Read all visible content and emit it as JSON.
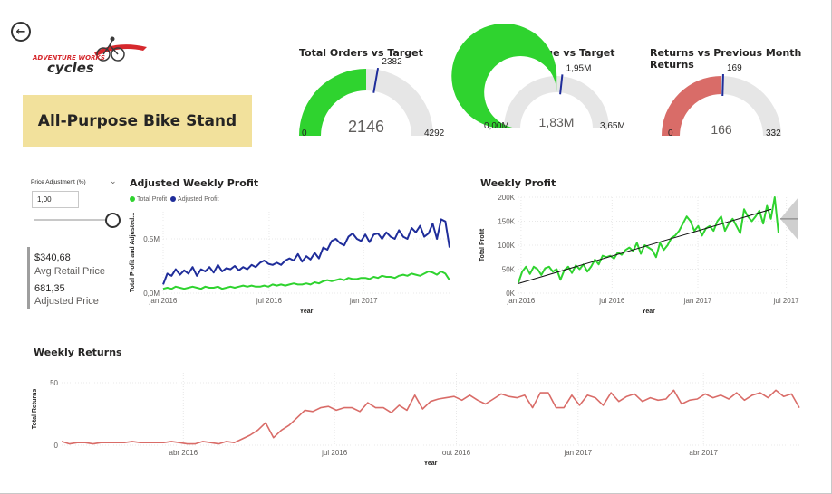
{
  "brand": {
    "logo_text_top": "ADVENTURE WORKS",
    "logo_text_bottom": "cycles"
  },
  "product": {
    "name": "All-Purpose Bike Stand"
  },
  "price_adjustment": {
    "label": "Price Adjustment (%)",
    "value": "1,00",
    "slider_fraction": 1.0
  },
  "kpis": {
    "avg_retail_value": "$340,68",
    "avg_retail_label": "Avg Retail Price",
    "adjusted_value": "681,35",
    "adjusted_label": "Adjusted Price"
  },
  "colors": {
    "green": "#2fd32f",
    "navy": "#1f2d9a",
    "red": "#d96c68",
    "gray": "#e6e6e6",
    "target": "#1f2d9a"
  },
  "gauges": [
    {
      "title": "Total Orders vs Target",
      "value_label": "2146",
      "min_label": "0",
      "max_label": "4292",
      "target_label": "2382",
      "value": 2146,
      "min": 0,
      "max": 4292,
      "target": 2382,
      "color": "#2fd32f"
    },
    {
      "title": "Total Revenue vs Target",
      "value_label": "1,83M",
      "min_label": "0,00M",
      "max_label": "3,65M",
      "target_label": "1,95M",
      "value": 1.83,
      "min": 0,
      "max": 3.65,
      "target": 1.95,
      "color": "#2fd32f"
    },
    {
      "title": "Returns vs Previous Month Returns",
      "value_label": "166",
      "min_label": "0",
      "max_label": "332",
      "target_label": "169",
      "value": 166,
      "min": 0,
      "max": 332,
      "target": 169,
      "color": "#d96c68"
    }
  ],
  "chart_data": [
    {
      "type": "line",
      "title": "Adjusted Weekly Profit",
      "xlabel": "Year",
      "ylabel": "Total Profit and Adjusted...",
      "x_ticks": [
        "jan 2016",
        "jul 2016",
        "jan 2017"
      ],
      "y_ticks": [
        "0,0M",
        "0,5M"
      ],
      "ylim": [
        0,
        0.75
      ],
      "legend_position": "top-left",
      "series": [
        {
          "name": "Total Profit",
          "color": "#2fd32f",
          "values": [
            0.04,
            0.05,
            0.04,
            0.06,
            0.05,
            0.04,
            0.05,
            0.06,
            0.05,
            0.04,
            0.06,
            0.05,
            0.05,
            0.06,
            0.04,
            0.05,
            0.06,
            0.05,
            0.06,
            0.07,
            0.06,
            0.07,
            0.06,
            0.06,
            0.07,
            0.06,
            0.08,
            0.07,
            0.08,
            0.07,
            0.08,
            0.09,
            0.08,
            0.08,
            0.09,
            0.08,
            0.1,
            0.09,
            0.11,
            0.12,
            0.11,
            0.12,
            0.13,
            0.12,
            0.14,
            0.13,
            0.13,
            0.14,
            0.14,
            0.13,
            0.15,
            0.14,
            0.16,
            0.15,
            0.15,
            0.14,
            0.16,
            0.17,
            0.16,
            0.18,
            0.17,
            0.16,
            0.18,
            0.2,
            0.19,
            0.17,
            0.2,
            0.18,
            0.12
          ]
        },
        {
          "name": "Adjusted Profit",
          "color": "#1f2d9a",
          "values": [
            0.08,
            0.18,
            0.16,
            0.22,
            0.17,
            0.21,
            0.18,
            0.24,
            0.16,
            0.22,
            0.2,
            0.24,
            0.19,
            0.26,
            0.2,
            0.23,
            0.22,
            0.25,
            0.21,
            0.24,
            0.22,
            0.26,
            0.24,
            0.28,
            0.3,
            0.27,
            0.26,
            0.28,
            0.26,
            0.3,
            0.32,
            0.3,
            0.36,
            0.29,
            0.34,
            0.31,
            0.37,
            0.32,
            0.42,
            0.4,
            0.48,
            0.5,
            0.46,
            0.44,
            0.52,
            0.55,
            0.5,
            0.48,
            0.54,
            0.47,
            0.54,
            0.55,
            0.5,
            0.56,
            0.52,
            0.5,
            0.58,
            0.52,
            0.5,
            0.6,
            0.56,
            0.62,
            0.52,
            0.55,
            0.64,
            0.5,
            0.68,
            0.66,
            0.42
          ]
        }
      ]
    },
    {
      "type": "line",
      "title": "Weekly Profit",
      "xlabel": "Year",
      "ylabel": "Total Profit",
      "x_ticks": [
        "jan 2016",
        "jul 2016",
        "jan 2017",
        "jul 2017"
      ],
      "y_ticks": [
        "0K",
        "50K",
        "100K",
        "150K",
        "200K"
      ],
      "ylim": [
        0,
        200000
      ],
      "trend": {
        "start": 20000,
        "end": 175000
      },
      "forecast": {
        "low": 110000,
        "high": 200000,
        "mid": 155000
      },
      "series": [
        {
          "name": "Total Profit",
          "color": "#2fd32f",
          "values": [
            22000,
            45000,
            55000,
            40000,
            55000,
            50000,
            38000,
            52000,
            55000,
            45000,
            50000,
            28000,
            48000,
            55000,
            42000,
            58000,
            50000,
            60000,
            45000,
            55000,
            70000,
            60000,
            78000,
            75000,
            78000,
            72000,
            85000,
            80000,
            90000,
            95000,
            88000,
            105000,
            82000,
            100000,
            95000,
            90000,
            75000,
            105000,
            90000,
            100000,
            115000,
            120000,
            130000,
            145000,
            160000,
            150000,
            130000,
            140000,
            120000,
            135000,
            140000,
            130000,
            150000,
            160000,
            130000,
            145000,
            155000,
            140000,
            125000,
            175000,
            160000,
            150000,
            160000,
            172000,
            145000,
            182000,
            155000,
            200000,
            125000
          ]
        }
      ]
    },
    {
      "type": "line",
      "title": "Weekly Returns",
      "xlabel": "Year",
      "ylabel": "Total Returns",
      "x_ticks": [
        "abr 2016",
        "jul 2016",
        "out 2016",
        "jan 2017",
        "abr 2017"
      ],
      "y_ticks": [
        "0",
        "50"
      ],
      "ylim": [
        0,
        58
      ],
      "series": [
        {
          "name": "Total Returns",
          "color": "#d96c68",
          "values": [
            3,
            1,
            2,
            2,
            1,
            2,
            2,
            2,
            2,
            3,
            2,
            2,
            2,
            2,
            3,
            2,
            1,
            1,
            3,
            2,
            1,
            3,
            2,
            5,
            8,
            12,
            18,
            6,
            12,
            16,
            22,
            28,
            27,
            30,
            31,
            28,
            30,
            30,
            27,
            34,
            30,
            30,
            26,
            32,
            28,
            40,
            29,
            35,
            37,
            38,
            39,
            36,
            40,
            36,
            33,
            37,
            41,
            39,
            38,
            40,
            30,
            42,
            42,
            30,
            30,
            40,
            32,
            40,
            38,
            32,
            42,
            35,
            39,
            41,
            35,
            38,
            36,
            37,
            44,
            33,
            36,
            37,
            41,
            38,
            40,
            37,
            42,
            36,
            40,
            42,
            38,
            44,
            39,
            41,
            30
          ]
        }
      ]
    }
  ]
}
